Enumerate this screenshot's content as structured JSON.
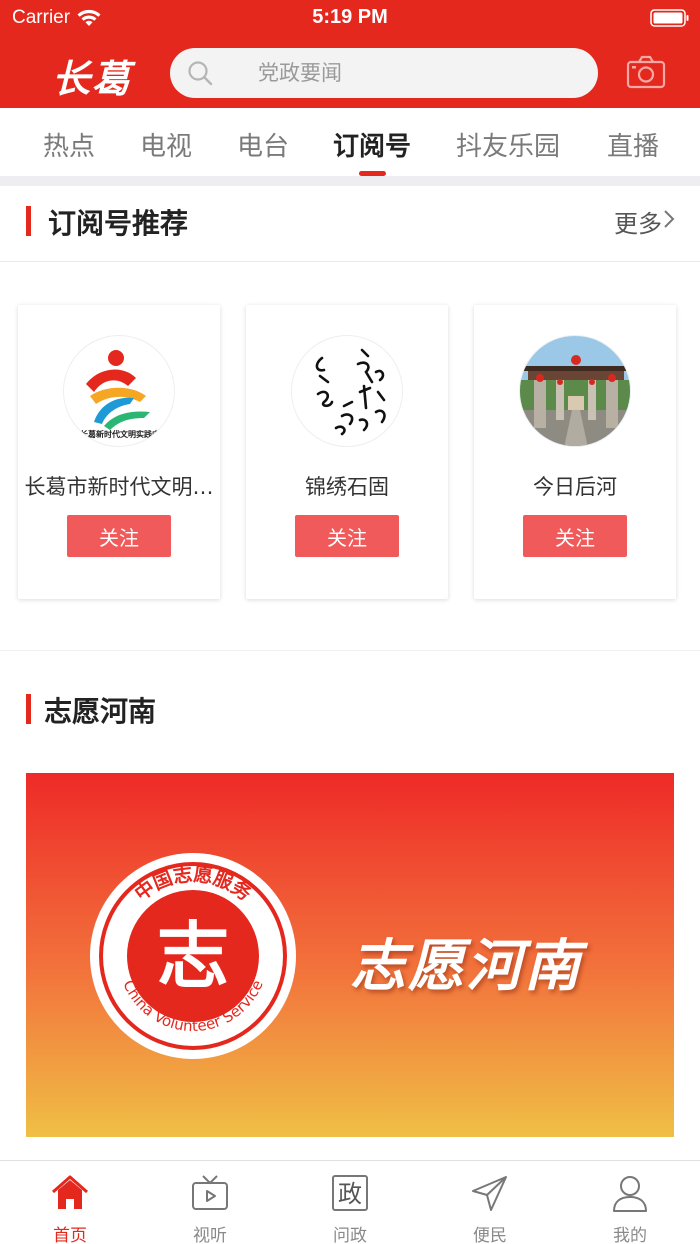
{
  "status_bar": {
    "carrier": "Carrier",
    "time": "5:19 PM"
  },
  "header": {
    "logo": "长葛",
    "search_placeholder": "党政要闻"
  },
  "tabs": [
    {
      "label": "热点"
    },
    {
      "label": "电视"
    },
    {
      "label": "电台"
    },
    {
      "label": "订阅号",
      "active": true
    },
    {
      "label": "抖友乐园"
    },
    {
      "label": "直播"
    }
  ],
  "subscriptions": {
    "title": "订阅号推荐",
    "more": "更多",
    "cards": [
      {
        "name": "长葛市新时代文明…",
        "avatar_text": "长葛新时代文明实践中",
        "follow_label": "关注"
      },
      {
        "name": "锦绣石固",
        "follow_label": "关注"
      },
      {
        "name": "今日后河",
        "follow_label": "关注"
      }
    ]
  },
  "volunteer": {
    "title": "志愿河南",
    "banner_text": "志愿河南",
    "badge_top_text": "中国志愿服务",
    "badge_bottom_text": "China Volunteer Service",
    "badge_center": "志"
  },
  "bottom_nav": [
    {
      "label": "首页",
      "icon": "home-icon",
      "active": true
    },
    {
      "label": "视听",
      "icon": "tv-icon"
    },
    {
      "label": "问政",
      "icon": "politics-icon",
      "glyph": "政"
    },
    {
      "label": "便民",
      "icon": "send-icon"
    },
    {
      "label": "我的",
      "icon": "user-icon"
    }
  ],
  "colors": {
    "brand_red": "#e5281e",
    "follow_button": "#f05a5a"
  }
}
